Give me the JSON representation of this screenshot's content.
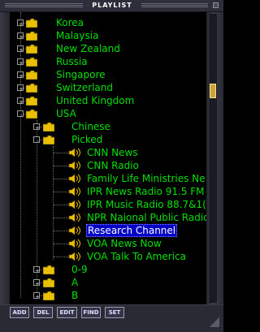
{
  "window": {
    "title": "PLAYLIST"
  },
  "tree": [
    {
      "label": "Korea",
      "kind": "folder",
      "expander": "+"
    },
    {
      "label": "Malaysia",
      "kind": "folder",
      "expander": "+"
    },
    {
      "label": "New Zealand",
      "kind": "folder",
      "expander": "+"
    },
    {
      "label": "Russia",
      "kind": "folder",
      "expander": "+"
    },
    {
      "label": "Singapore",
      "kind": "folder",
      "expander": "+"
    },
    {
      "label": "Switzerland",
      "kind": "folder",
      "expander": "+"
    },
    {
      "label": "United Kingdom",
      "kind": "folder",
      "expander": "+"
    },
    {
      "label": "USA",
      "kind": "folder",
      "expander": "-"
    },
    {
      "label": "Chinese",
      "kind": "folder",
      "expander": "+"
    },
    {
      "label": "Picked",
      "kind": "folder",
      "expander": "-"
    },
    {
      "label": "CNN News",
      "kind": "stream"
    },
    {
      "label": "CNN Radio",
      "kind": "stream"
    },
    {
      "label": "Family Life Ministries Ne",
      "kind": "stream"
    },
    {
      "label": "IPR News Radio 91.5 FM",
      "kind": "stream"
    },
    {
      "label": "IPR Music Radio 88.7&1(",
      "kind": "stream"
    },
    {
      "label": "NPR Naional Public Radio",
      "kind": "stream"
    },
    {
      "label": "Research Channel",
      "kind": "stream",
      "selected": true
    },
    {
      "label": "VOA News Now",
      "kind": "stream"
    },
    {
      "label": "VOA Talk To America",
      "kind": "stream"
    },
    {
      "label": "0-9",
      "kind": "folder",
      "expander": "+"
    },
    {
      "label": "A",
      "kind": "folder",
      "expander": "+"
    },
    {
      "label": "B",
      "kind": "folder",
      "expander": "+"
    }
  ],
  "buttons": {
    "add": "ADD",
    "del": "DEL",
    "edit": "EDIT",
    "find": "FIND",
    "set": "SET"
  },
  "colors": {
    "text": "#00e000",
    "selection": "#0000c6",
    "background": "#000000",
    "folder": "#e8c000"
  }
}
